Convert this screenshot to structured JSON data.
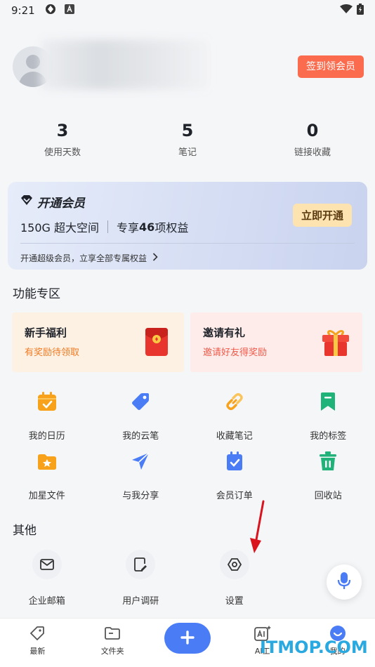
{
  "status_bar": {
    "time": "9:21"
  },
  "profile": {
    "signin_button": "签到领会员"
  },
  "stats": [
    {
      "value": "3",
      "label": "使用天数"
    },
    {
      "value": "5",
      "label": "笔记"
    },
    {
      "value": "0",
      "label": "链接收藏"
    }
  ],
  "vip": {
    "title": "开通会员",
    "benefit_space": "150G 超大空间",
    "benefit_rights_prefix": "专享",
    "benefit_rights_count": "46",
    "benefit_rights_suffix": "项权益",
    "button": "立即开通",
    "footer": "开通超级会员，立享全部专属权益"
  },
  "features": {
    "title": "功能专区",
    "promos": [
      {
        "title": "新手福利",
        "subtitle": "有奖励待领取",
        "color": "#f07a22"
      },
      {
        "title": "邀请有礼",
        "subtitle": "邀请好友得奖励",
        "color": "#f05a4a"
      }
    ],
    "row1": [
      {
        "label": "我的日历",
        "icon": "calendar-icon"
      },
      {
        "label": "我的云笔",
        "icon": "tag-pen-icon"
      },
      {
        "label": "收藏笔记",
        "icon": "link-icon"
      },
      {
        "label": "我的标签",
        "icon": "bookmark-icon"
      }
    ],
    "row2": [
      {
        "label": "加星文件",
        "icon": "star-folder-icon"
      },
      {
        "label": "与我分享",
        "icon": "send-icon"
      },
      {
        "label": "会员订单",
        "icon": "order-icon"
      },
      {
        "label": "回收站",
        "icon": "trash-icon"
      }
    ]
  },
  "other": {
    "title": "其他",
    "items": [
      {
        "label": "企业邮箱",
        "icon": "mail-icon"
      },
      {
        "label": "用户调研",
        "icon": "survey-icon"
      },
      {
        "label": "设置",
        "icon": "settings-icon"
      }
    ]
  },
  "tabbar": {
    "tabs": [
      {
        "label": "最新"
      },
      {
        "label": "文件夹"
      },
      {
        "label": ""
      },
      {
        "label": "AI工"
      },
      {
        "label": "我的"
      }
    ]
  },
  "watermark": "ITMOP.COM",
  "colors": {
    "accent": "#4a7cf6",
    "signin": "#fb6b4d",
    "icon_orange": "#f7a21a",
    "icon_blue": "#4a7cf6",
    "icon_green": "#1fb37a"
  }
}
